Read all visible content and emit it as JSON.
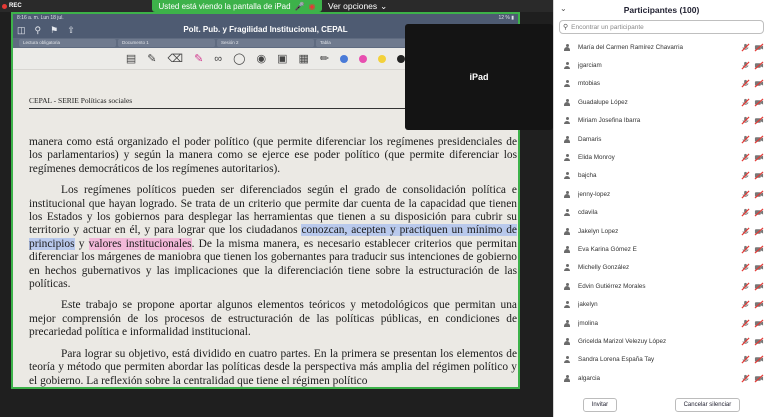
{
  "share": {
    "rec_label": "REC",
    "banner_text": "Usted está viendo la pantalla de iPad",
    "view_options": "Ver opciones",
    "ipad_label": "iPad"
  },
  "ipad": {
    "status_left": "8:16 a. m.   Lun 18 jul.",
    "status_right": "12 % ▮",
    "doc_title": "Polt. Pub. y Fragilidad Institucional, CEPAL",
    "tabs": [
      "Lectura obligatoria",
      "Documento 1",
      "Sesión 2",
      "Tabla",
      "Pol. Pub. y Fragilidad"
    ],
    "colors": {
      "status_bar": "#4e5b72",
      "highlight_blue": "#b9c9ec",
      "highlight_pink": "#f2b9d9",
      "swatch_blue": "#4a7bd8",
      "swatch_pink": "#e84fb0",
      "swatch_yellow": "#f3d13a",
      "swatch_black": "#222222"
    }
  },
  "document": {
    "header": "CEPAL - SERIE Políticas sociales",
    "p1": "manera como está organizado el poder político (que permite diferenciar los regímenes presidenciales de los parlamentarios) y según la manera como se ejerce ese poder político (que permite diferenciar los regímenes democráticos de los regímenes autoritarios).",
    "p2_a": "Los regímenes políticos pueden ser diferenciados según el grado de consolidación política e institucional que hayan logrado. Se trata de un criterio que permite dar cuenta de la capacidad que tienen los Estados y los gobiernos para desplegar las herramientas que tienen a su disposición para cubrir su territorio y actuar en él, y para lograr que los ciudadanos ",
    "p2_hl1": "conozcan, acepten y practiquen un mínimo de principios",
    "p2_b": " y ",
    "p2_hl2": "valores institucionales",
    "p2_c": ". De la misma manera, es necesario establecer criterios que permitan diferenciar los márgenes de maniobra que tienen los gobernantes para traducir sus intenciones de gobierno en hechos gubernativos y las implicaciones que la diferenciación tiene sobre la estructuración de las políticas.",
    "p3": "Este trabajo se propone aportar algunos elementos teóricos y metodológicos que permitan una mejor comprensión de los procesos de estructuración de las políticas públicas, en condiciones de precariedad política e informalidad institucional.",
    "p4": "Para lograr su objetivo, está dividido en cuatro partes. En la primera se presentan los elementos de teoría y método que permiten abordar las políticas desde la perspectiva más amplia del régimen político y el gobierno. La reflexión sobre la centralidad que tiene el régimen político"
  },
  "panel": {
    "title": "Participantes (100)",
    "search_placeholder": "Encontrar un participante",
    "invite_label": "Invitar",
    "unmute_label": "Cancelar silenciar",
    "participants": [
      "María del Carmen Ramírez Chavarria",
      "jgarciam",
      "mtobias",
      "Guadalupe López",
      "Miriam Josefina Ibarra",
      "Damaris",
      "Elida Monroy",
      "bajcha",
      "jenny-lopez",
      "cdavila",
      "Jakelyn Lopez",
      "Eva Karina Gómez E",
      "Michelly González",
      "Edvin Gutiérrez Morales",
      "jakelyn",
      "jmolina",
      "Gricelda Marizol Velezuy López",
      "Sandra Lorena España Tay",
      "algarcia"
    ]
  }
}
